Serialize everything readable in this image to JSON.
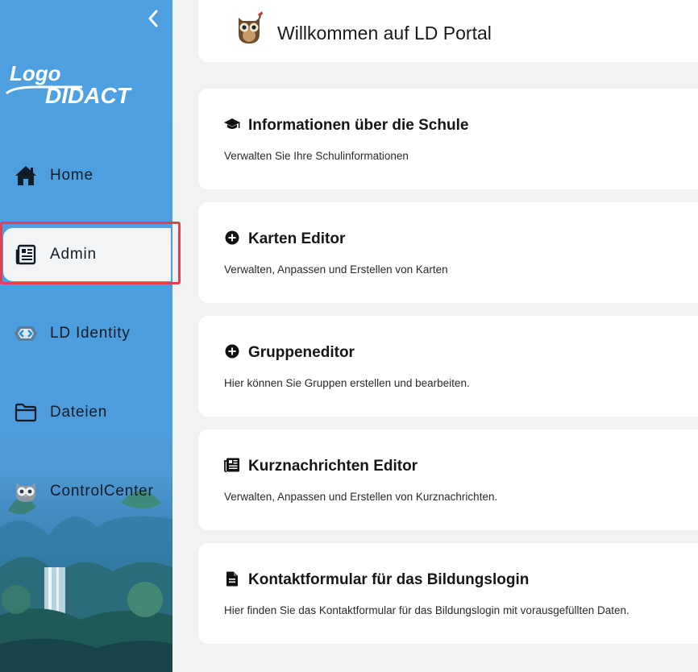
{
  "sidebar": {
    "logo_text_top": "Logo",
    "logo_text_bottom": "DIDACT",
    "items": [
      {
        "label": "Home",
        "icon": "home-icon"
      },
      {
        "label": "Admin",
        "icon": "newspaper-icon",
        "active": true
      },
      {
        "label": "LD Identity",
        "icon": "identity-icon"
      },
      {
        "label": "Dateien",
        "icon": "folder-icon"
      },
      {
        "label": "ControlCenter",
        "icon": "owl-icon"
      }
    ]
  },
  "header": {
    "title": "Willkommen auf LD Portal"
  },
  "cards": [
    {
      "title": "Informationen über die Schule",
      "description": "Verwalten Sie Ihre Schulinformationen",
      "icon": "graduation-cap-icon"
    },
    {
      "title": "Karten Editor",
      "description": "Verwalten, Anpassen und Erstellen von Karten",
      "icon": "plus-circle-icon"
    },
    {
      "title": "Gruppeneditor",
      "description": "Hier können Sie Gruppen erstellen und bearbeiten.",
      "icon": "plus-circle-icon"
    },
    {
      "title": "Kurznachrichten Editor",
      "description": "Verwalten, Anpassen und Erstellen von Kurznachrichten.",
      "icon": "newspaper-icon"
    },
    {
      "title": "Kontaktformular für das Bildungslogin",
      "description": "Hier finden Sie das Kontaktformular für das Bildungslogin mit vorausgefüllten Daten.",
      "icon": "document-icon"
    }
  ],
  "colors": {
    "sidebar_blue": "#4ea0e0",
    "highlight_red": "#e0424b",
    "page_background": "#f1f2f4"
  }
}
